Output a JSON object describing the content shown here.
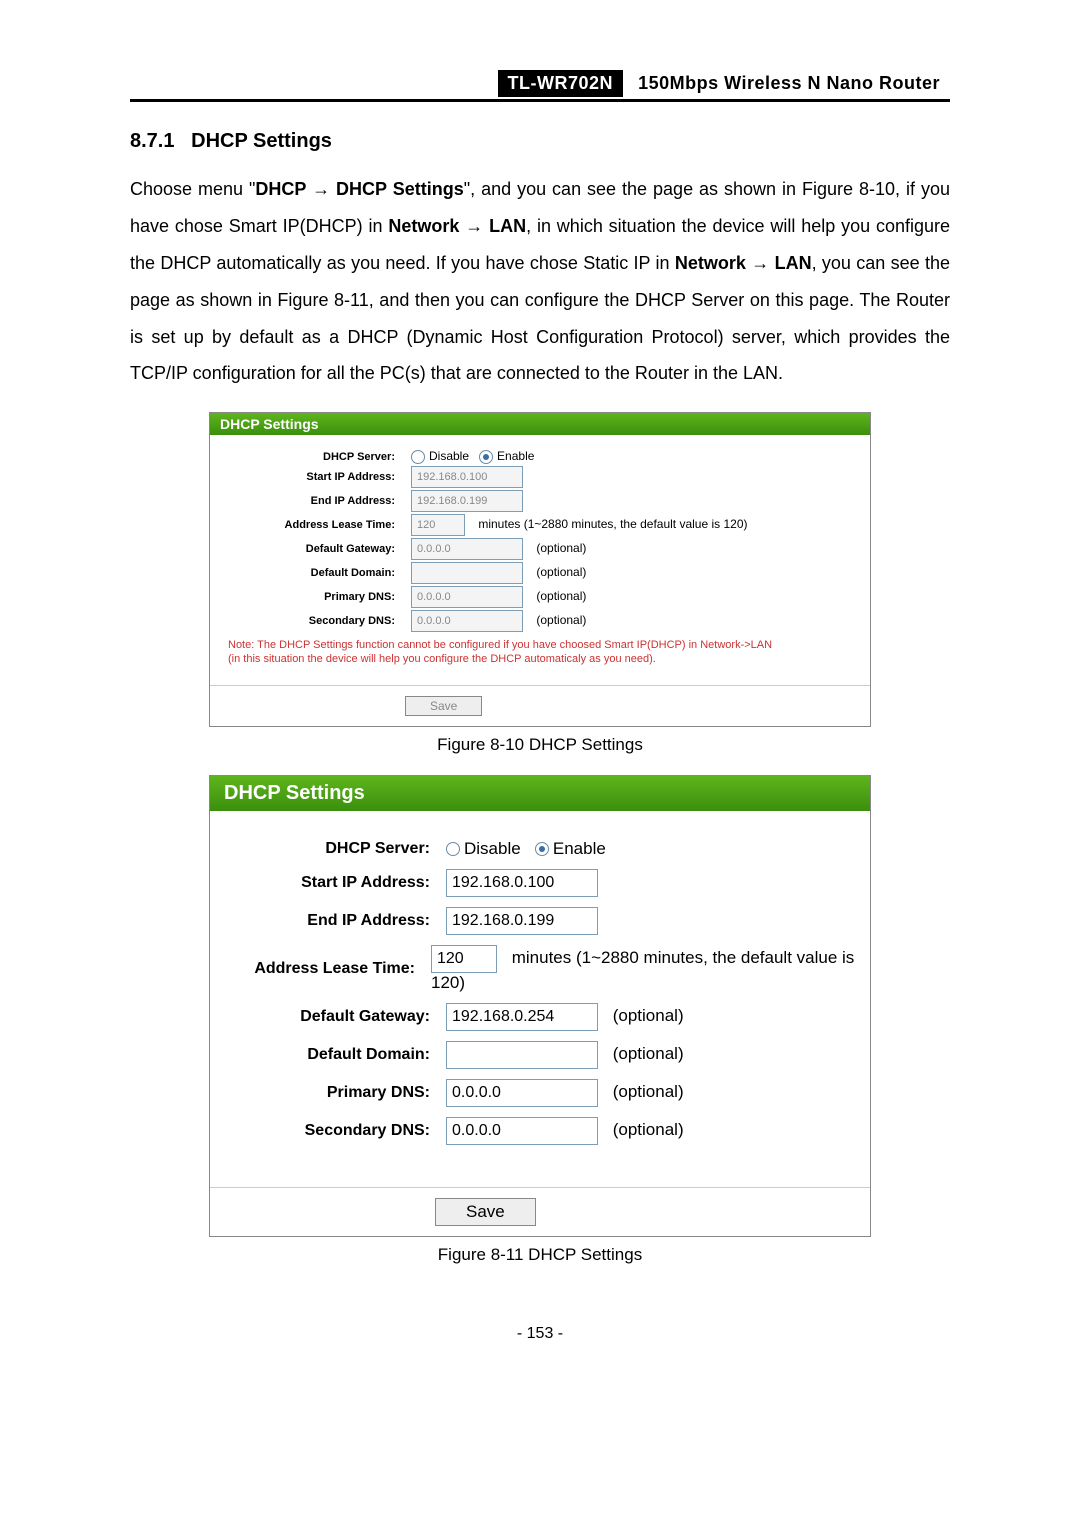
{
  "header": {
    "model": "TL-WR702N",
    "desc": "150Mbps Wireless N Nano Router"
  },
  "section": {
    "number": "8.7.1",
    "title": "DHCP Settings"
  },
  "paragraph": {
    "p1a": "Choose menu \"",
    "dhcp": "DHCP",
    "arrow1": " → ",
    "dhcp_settings": "DHCP Settings",
    "p1b": "\", and you can see the page as shown in Figure 8-10, if you have chose Smart IP(DHCP) in ",
    "network": "Network",
    "arrow2": " → ",
    "lan": "LAN",
    "p1c": ", in which situation the device will help you configure the DHCP automatically as you need. If you have chose Static IP in ",
    "network2": "Network",
    "arrow3": " → ",
    "lan2": "LAN",
    "p1d": ", you can see the page as shown in Figure 8-11, and then you can configure the DHCP Server on this page. The Router is set up by default as a DHCP (Dynamic Host Configuration Protocol) server, which provides the TCP/IP configuration for all the PC(s) that are connected to the Router in the LAN."
  },
  "panel_common": {
    "title": "DHCP Settings",
    "labels": {
      "dhcp_server": "DHCP Server:",
      "start_ip": "Start IP Address:",
      "end_ip": "End IP Address:",
      "lease": "Address Lease Time:",
      "gateway": "Default Gateway:",
      "domain": "Default Domain:",
      "pdns": "Primary DNS:",
      "sdns": "Secondary DNS:"
    },
    "radio_disable": "Disable",
    "radio_enable": "Enable",
    "lease_hint": "minutes (1~2880 minutes, the default value is 120)",
    "optional": "(optional)",
    "save": "Save"
  },
  "panel1": {
    "start_ip": "192.168.0.100",
    "end_ip": "192.168.0.199",
    "lease": "120",
    "gateway": "0.0.0.0",
    "domain": "",
    "pdns": "0.0.0.0",
    "sdns": "0.0.0.0",
    "note1": "Note: The DHCP Settings function cannot be configured if you have choosed Smart IP(DHCP) in Network->LAN",
    "note2": "(in this situation the device will help you configure the DHCP automaticaly as you need)."
  },
  "panel2": {
    "start_ip": "192.168.0.100",
    "end_ip": "192.168.0.199",
    "lease": "120",
    "gateway": "192.168.0.254",
    "domain": "",
    "pdns": "0.0.0.0",
    "sdns": "0.0.0.0"
  },
  "caption1": "Figure 8-10 DHCP Settings",
  "caption2": "Figure 8-11 DHCP Settings",
  "pagenum": "- 153 -"
}
